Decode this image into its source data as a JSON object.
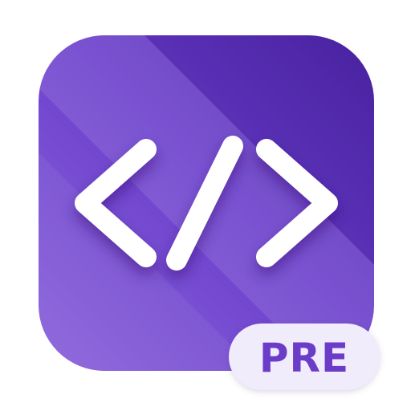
{
  "badge": {
    "label": "PRE"
  },
  "icon": {
    "glyph": "code-brackets-icon",
    "colors": {
      "tile_light": "#8a63da",
      "tile_mid": "#6b3fcc",
      "tile_dark": "#4f27a8",
      "glyph": "#ffffff",
      "badge_background": "#f1ecfb",
      "badge_text": "#6a3cc8"
    }
  }
}
